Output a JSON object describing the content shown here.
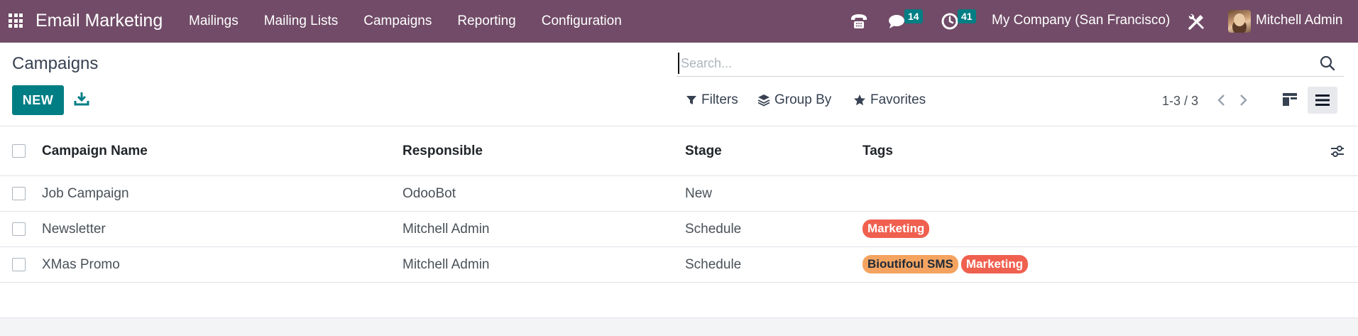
{
  "navbar": {
    "brand": "Email Marketing",
    "menu": [
      "Mailings",
      "Mailing Lists",
      "Campaigns",
      "Reporting",
      "Configuration"
    ],
    "chat_badge": "14",
    "activity_badge": "41",
    "company": "My Company (San Francisco)",
    "user": "Mitchell Admin",
    "icons": [
      "apps-grid-icon",
      "phone-icon",
      "chat-icon",
      "clock-icon",
      "tools-icon"
    ]
  },
  "control": {
    "title": "Campaigns",
    "new_label": "NEW",
    "search_placeholder": "Search...",
    "filters_label": "Filters",
    "group_by_label": "Group By",
    "favorites_label": "Favorites",
    "pager": "1-3 / 3"
  },
  "list": {
    "columns": [
      "Campaign Name",
      "Responsible",
      "Stage",
      "Tags"
    ],
    "rows": [
      {
        "name": "Job Campaign",
        "responsible": "OdooBot",
        "stage": "New",
        "tags": []
      },
      {
        "name": "Newsletter",
        "responsible": "Mitchell Admin",
        "stage": "Schedule",
        "tags": [
          {
            "label": "Marketing",
            "color": "#f0604f",
            "text": "#ffffff"
          }
        ]
      },
      {
        "name": "XMas Promo",
        "responsible": "Mitchell Admin",
        "stage": "Schedule",
        "tags": [
          {
            "label": "Bioutifoul SMS",
            "color": "#f4a460",
            "text": "#1f2937"
          },
          {
            "label": "Marketing",
            "color": "#f0604f",
            "text": "#ffffff"
          }
        ]
      }
    ]
  },
  "colors": {
    "navbar": "#714b67",
    "primary": "#017e84",
    "tag_marketing": "#f0604f",
    "tag_sms": "#f4a460"
  }
}
